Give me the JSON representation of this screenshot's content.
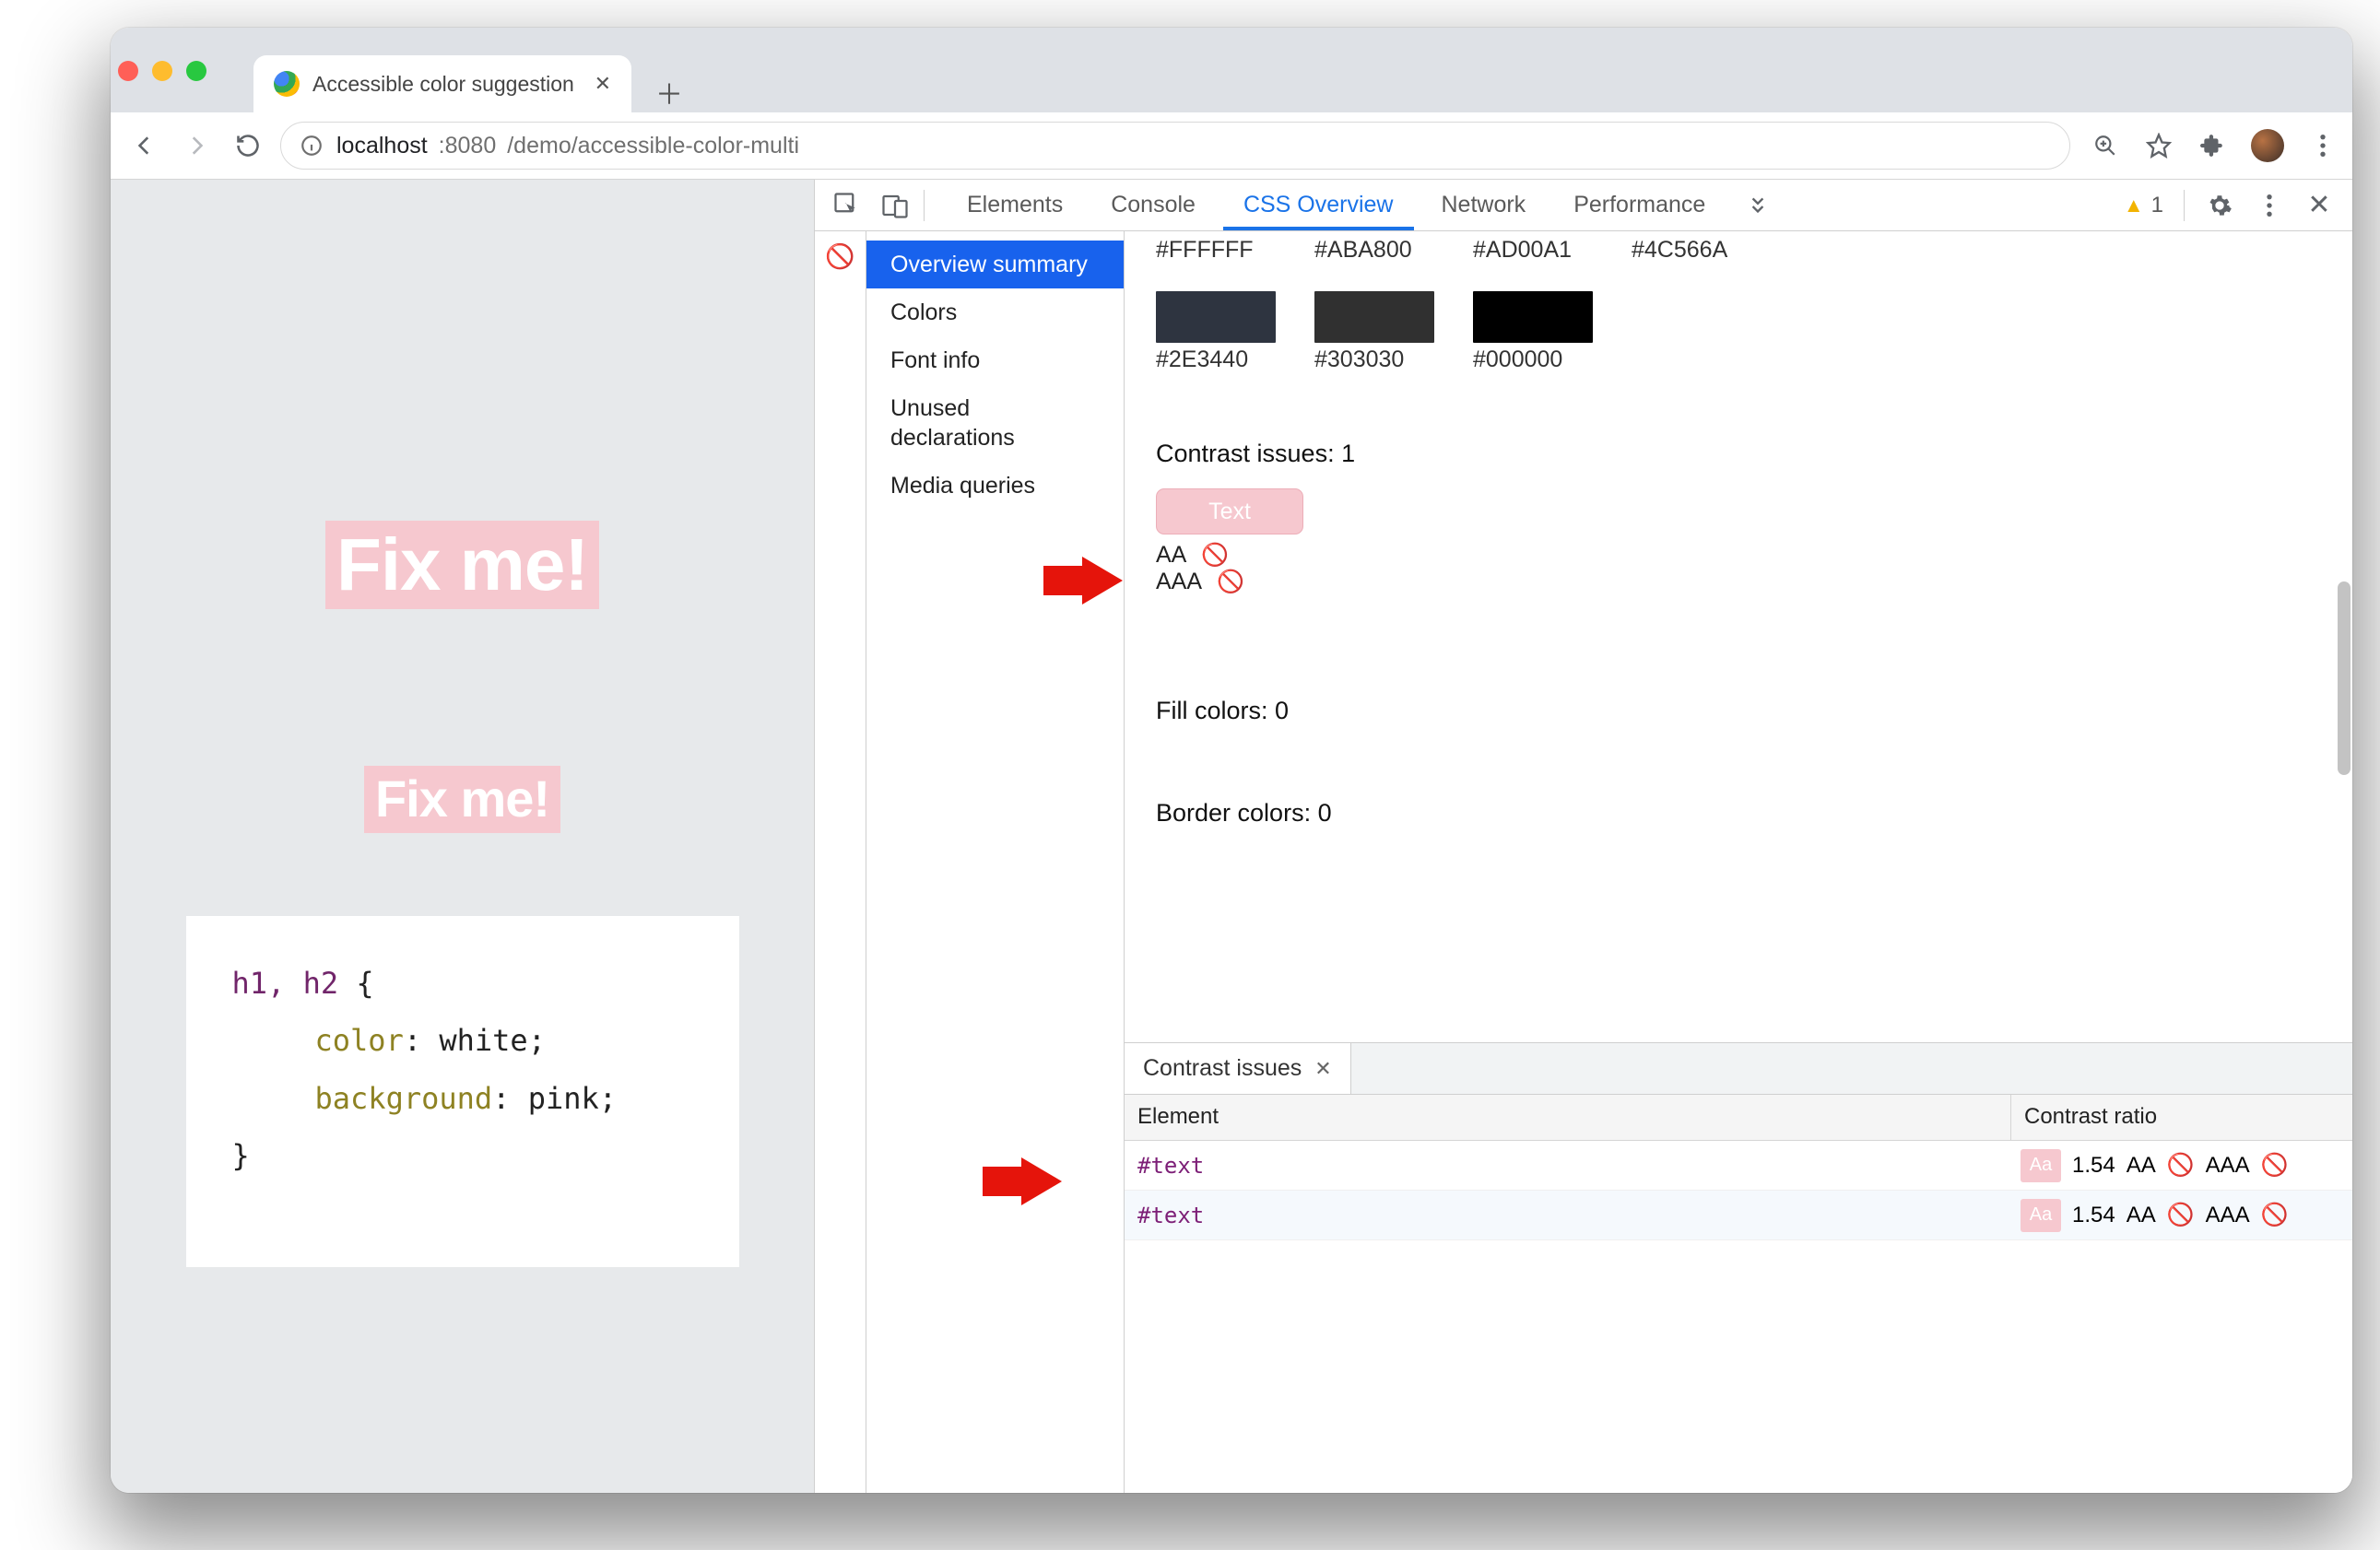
{
  "browser": {
    "tab_title": "Accessible color suggestion",
    "url_host": "localhost",
    "url_port": ":8080",
    "url_path": "/demo/accessible-color-multi"
  },
  "page": {
    "h1_text": "Fix me!",
    "h2_text": "Fix me!",
    "code_selector": "h1, h2",
    "code_open": " {",
    "code_prop1": "color",
    "code_val1": ": white;",
    "code_prop2": "background",
    "code_val2": ": pink;",
    "code_close": "}"
  },
  "devtools": {
    "tabs": {
      "elements": "Elements",
      "console": "Console",
      "css_overview": "CSS Overview",
      "network": "Network",
      "performance": "Performance"
    },
    "warn_count": "1",
    "sidebar": {
      "overview": "Overview summary",
      "colors": "Colors",
      "font": "Font info",
      "unused": "Unused declarations",
      "media": "Media queries"
    },
    "top_swatch_caps": {
      "a": "#FFFFFF",
      "b": "#ABA800",
      "c": "#AD00A1",
      "d": "#4C566A"
    },
    "swatches": {
      "a": "#2E3440",
      "b": "#303030",
      "c": "#000000"
    },
    "contrast_issues_label": "Contrast issues: 1",
    "text_swatch_label": "Text",
    "aa_label": "AA",
    "aaa_label": "AAA",
    "fill_label": "Fill colors: 0",
    "border_label": "Border colors: 0",
    "drawer": {
      "tab_label": "Contrast issues",
      "col_element": "Element",
      "col_ratio": "Contrast ratio",
      "rows": [
        {
          "el": "#text",
          "chip": "Aa",
          "ratio": "1.54",
          "aa": "AA",
          "aaa": "AAA"
        },
        {
          "el": "#text",
          "chip": "Aa",
          "ratio": "1.54",
          "aa": "AA",
          "aaa": "AAA"
        }
      ]
    }
  }
}
